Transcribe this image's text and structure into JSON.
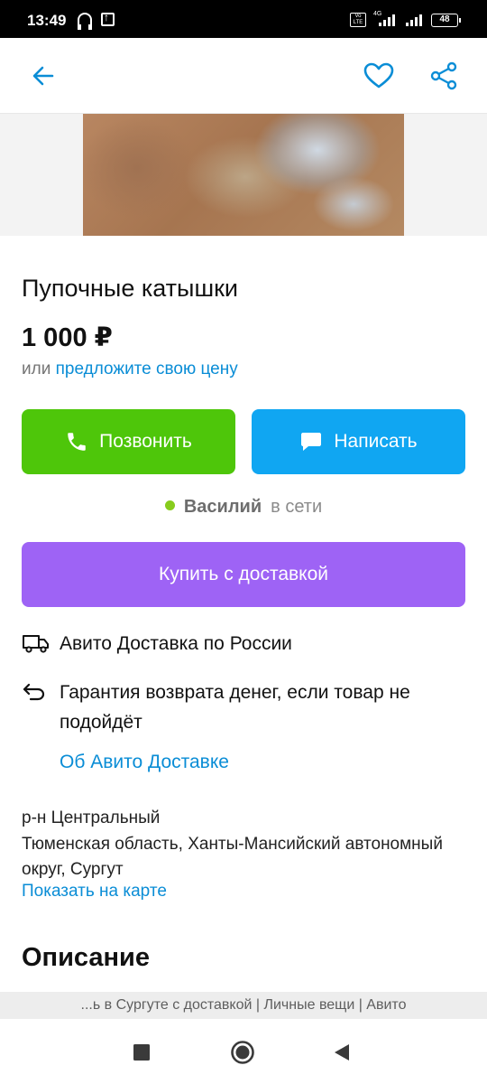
{
  "status_bar": {
    "time": "13:49",
    "volte": "Vo LTE",
    "network": "4G",
    "battery": "48"
  },
  "app_bar": {
    "back_icon": "arrow-left-icon",
    "favorite_icon": "heart-icon",
    "share_icon": "share-icon"
  },
  "listing": {
    "title": "Пупочные катышки",
    "price": "1 000 ₽",
    "offer_prefix": "или",
    "offer_link": "предложите свою цену"
  },
  "actions": {
    "call_label": "Позвонить",
    "message_label": "Написать",
    "buy_label": "Купить с доставкой"
  },
  "seller": {
    "name": "Василий",
    "status": "в сети"
  },
  "delivery": {
    "delivery_text": "Авито Доставка по России",
    "guarantee_text": "Гарантия возврата денег, если товар не подойдёт",
    "about_link": "Об Авито Доставке"
  },
  "location": {
    "district": "р-н Центральный",
    "region": "Тюменская область, Ханты-Мансийский автономный округ, Сургут",
    "map_link": "Показать на карте"
  },
  "description": {
    "heading": "Описание"
  },
  "page_strip": {
    "text": "...ь в Сургуте с доставкой | Личные вещи | Авито"
  },
  "colors": {
    "call": "#4ec60a",
    "message": "#10a6f2",
    "buy": "#9e63f5",
    "link": "#0a8dd6",
    "online": "#87cc1d"
  }
}
